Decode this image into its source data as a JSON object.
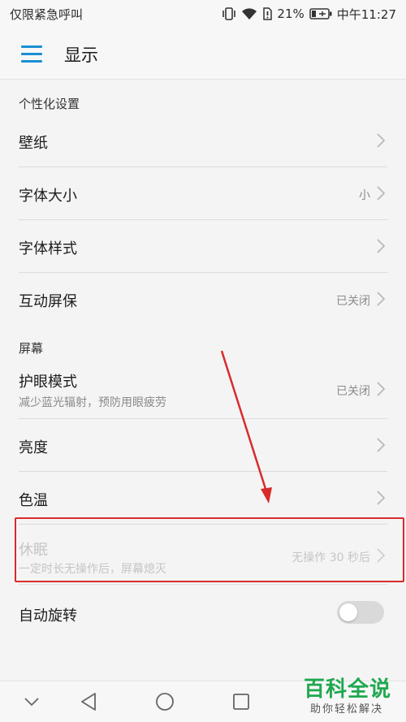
{
  "status_bar": {
    "carrier": "仅限紧急呼叫",
    "battery_percent": "21%",
    "time": "中午11:27"
  },
  "app_bar": {
    "title": "显示"
  },
  "sections": {
    "personalization": {
      "header": "个性化设置",
      "wallpaper": {
        "title": "壁纸"
      },
      "font_size": {
        "title": "字体大小",
        "value": "小"
      },
      "font_style": {
        "title": "字体样式"
      },
      "screensaver": {
        "title": "互动屏保",
        "value": "已关闭"
      }
    },
    "screen": {
      "header": "屏幕",
      "eye_comfort": {
        "title": "护眼模式",
        "subtitle": "减少蓝光辐射，预防用眼疲劳",
        "value": "已关闭"
      },
      "brightness": {
        "title": "亮度"
      },
      "color_temp": {
        "title": "色温"
      },
      "sleep": {
        "title": "休眠",
        "subtitle": "一定时长无操作后，屏幕熄灭",
        "value": "无操作 30 秒后"
      },
      "auto_rotate": {
        "title": "自动旋转",
        "toggle_on": false
      }
    }
  },
  "watermark": {
    "title": "百科全说",
    "subtitle": "助你轻松解决"
  },
  "colors": {
    "accent": "#1b8fd4",
    "highlight": "#d92b2b",
    "watermark": "#1fa84f"
  }
}
